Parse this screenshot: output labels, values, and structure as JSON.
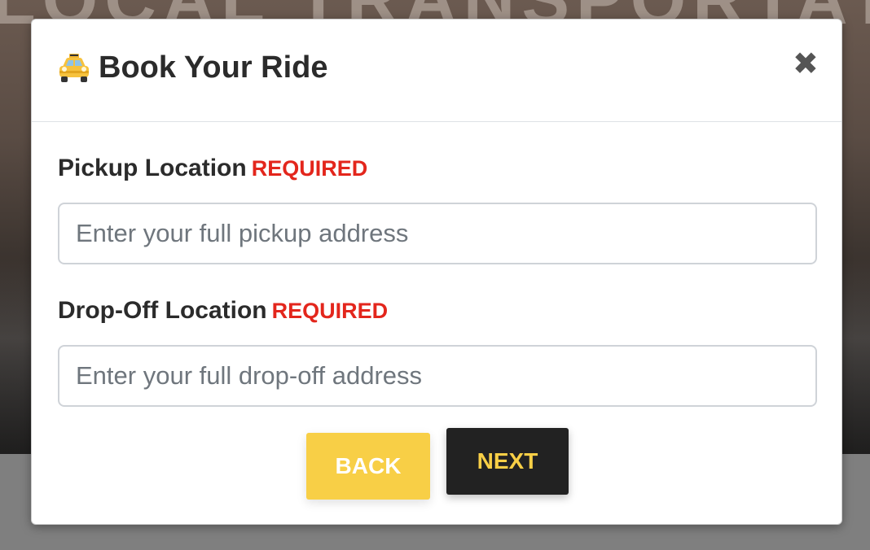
{
  "background": {
    "hero_title": "LOCAL TRANSPORTATION"
  },
  "modal": {
    "title": "Book Your Ride",
    "title_icon": "taxi-icon",
    "close_icon": "close-icon",
    "close_symbol": "✖"
  },
  "form": {
    "pickup": {
      "label": "Pickup Location",
      "required": "REQUIRED",
      "placeholder": "Enter your full pickup address",
      "value": ""
    },
    "dropoff": {
      "label": "Drop-Off Location",
      "required": "REQUIRED",
      "placeholder": "Enter your full drop-off address",
      "value": ""
    }
  },
  "buttons": {
    "back": "BACK",
    "next": "NEXT"
  },
  "colors": {
    "accent": "#f8cf46",
    "required": "#e3261c",
    "dark_button": "#222222"
  }
}
